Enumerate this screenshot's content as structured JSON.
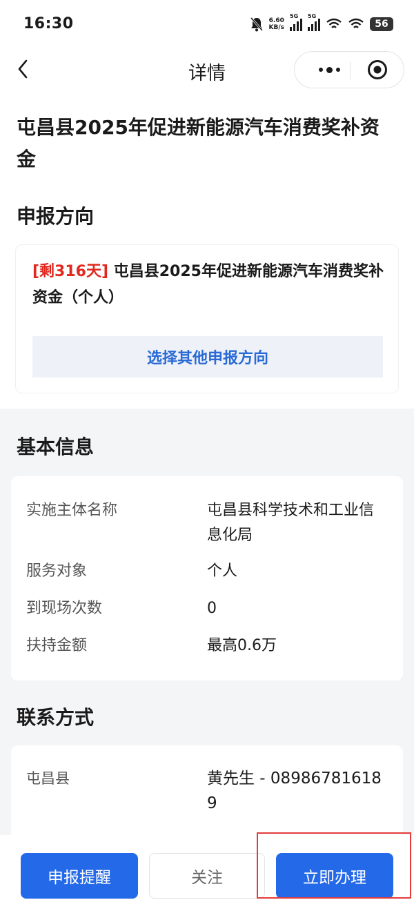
{
  "status_bar": {
    "time": "16:30",
    "speed_value": "6.60",
    "speed_unit": "KB/s",
    "signal1_label": "5G",
    "signal2_label": "5G",
    "battery": "56"
  },
  "nav": {
    "title": "详情"
  },
  "main_title": "屯昌县2025年促进新能源汽车消费奖补资金",
  "direction": {
    "heading": "申报方向",
    "remaining": "[剩316天]",
    "name": "屯昌县2025年促进新能源汽车消费奖补资金（个人）",
    "select_label": "选择其他申报方向"
  },
  "basic_info": {
    "heading": "基本信息",
    "rows": [
      {
        "label": "实施主体名称",
        "value": "屯昌县科学技术和工业信息化局"
      },
      {
        "label": "服务对象",
        "value": "个人"
      },
      {
        "label": "到现场次数",
        "value": "0"
      },
      {
        "label": "扶持金额",
        "value": "最高0.6万"
      }
    ]
  },
  "contact": {
    "heading": "联系方式",
    "rows": [
      {
        "label": "屯昌县",
        "value": "黄先生 - 08986781618 9"
      }
    ]
  },
  "bottom": {
    "remind_label": "申报提醒",
    "follow_label": "关注",
    "apply_label": "立即办理"
  },
  "colors": {
    "primary": "#2369e8",
    "accent_red": "#e0281e",
    "link_blue": "#2a6ad6"
  }
}
